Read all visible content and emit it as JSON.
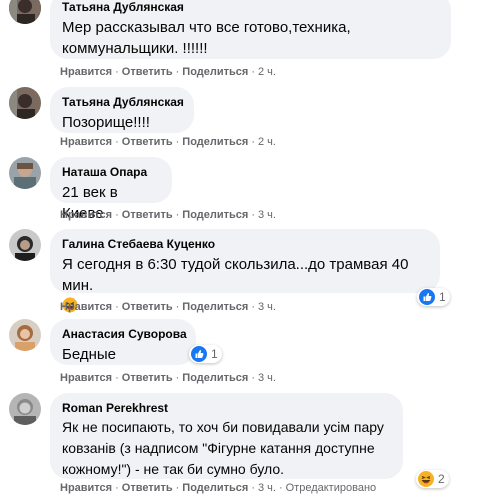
{
  "actions": {
    "like": "Нравится",
    "reply": "Ответить",
    "share": "Поделиться",
    "separator": "·"
  },
  "comments": [
    {
      "author": "Татьяна Дублянская",
      "lines": [
        "Мер рассказывал что все готово,техника,",
        "коммунальщики. !!!!!!"
      ],
      "time": "2 ч."
    },
    {
      "author": "Татьяна Дублянская",
      "lines": [
        "Позорище!!!!"
      ],
      "time": "2 ч."
    },
    {
      "author": "Наташа Опара",
      "lines": [
        "21 век в Киеве"
      ],
      "time": "3 ч."
    },
    {
      "author": "Галина Стебаева Куценко",
      "lines": [
        "Я сегодня в 6:30 тудой скользила...до трамвая 40 мин."
      ],
      "emoji": "laughing-emoji",
      "time": "3 ч.",
      "reaction_count": "1",
      "reaction_icon": "like-reaction-icon"
    },
    {
      "author": "Анастасия Суворова",
      "lines": [
        "Бедные"
      ],
      "time": "3 ч.",
      "reaction_count": "1",
      "reaction_icon": "like-reaction-icon"
    },
    {
      "author": "Roman Perekhrest",
      "lines": [
        "Як не посипають, то хоч би повидавали усім пару",
        "ковзанів (з надписом \"Фігурне катання доступне",
        "кожному!\") - не так би сумно було."
      ],
      "time": "3 ч.",
      "edited": "Отредактировано",
      "reaction_count": "2",
      "reaction_icon": "haha-reaction-icon"
    }
  ],
  "colors": {
    "bubble": "#f0f2f5",
    "meta": "#65676b",
    "like_blue": "#1877f2",
    "haha_yellow": "#f7b125"
  }
}
